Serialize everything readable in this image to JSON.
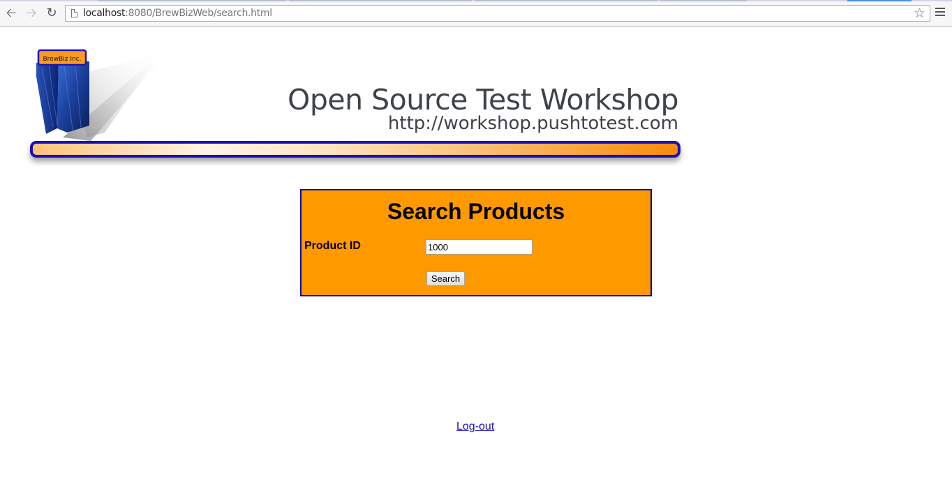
{
  "browser": {
    "url_host": "localhost",
    "url_rest": ":8080/BrewBizWeb/search.html"
  },
  "logo": {
    "brand_label": "BrewBiz Inc."
  },
  "header": {
    "title": "Open Source Test Workshop",
    "subtitle": "http://workshop.pushtotest.com"
  },
  "search_form": {
    "title": "Search Products",
    "product_id_label": "Product ID",
    "product_id_value": "1000",
    "search_button_label": "Search"
  },
  "footer": {
    "logout_label": "Log-out"
  },
  "colors": {
    "panel_bg": "#ff9900",
    "panel_border": "#0a0ab0",
    "header_bar_border": "#1a0fb0",
    "link": "#1a0dab",
    "title_text": "#3e4349"
  }
}
